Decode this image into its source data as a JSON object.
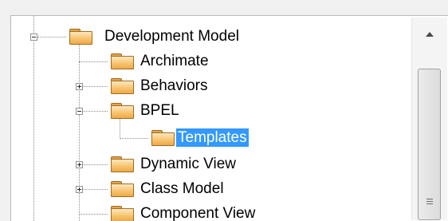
{
  "tree": {
    "items": [
      {
        "label": "Development Model",
        "expander": "minus"
      },
      {
        "label": "Archimate",
        "expander": "none"
      },
      {
        "label": "Behaviors",
        "expander": "plus"
      },
      {
        "label": "BPEL",
        "expander": "minus"
      },
      {
        "label": "Templates",
        "expander": "none",
        "selected": true
      },
      {
        "label": "Dynamic View",
        "expander": "plus"
      },
      {
        "label": "Class Model",
        "expander": "plus"
      },
      {
        "label": "Component View",
        "expander": "none"
      }
    ]
  },
  "icons": {
    "folder": "folder-icon",
    "scroll_up": "scroll-up-arrow-icon"
  },
  "colors": {
    "selection": "#3399ff",
    "folder": "#f7c16a"
  }
}
